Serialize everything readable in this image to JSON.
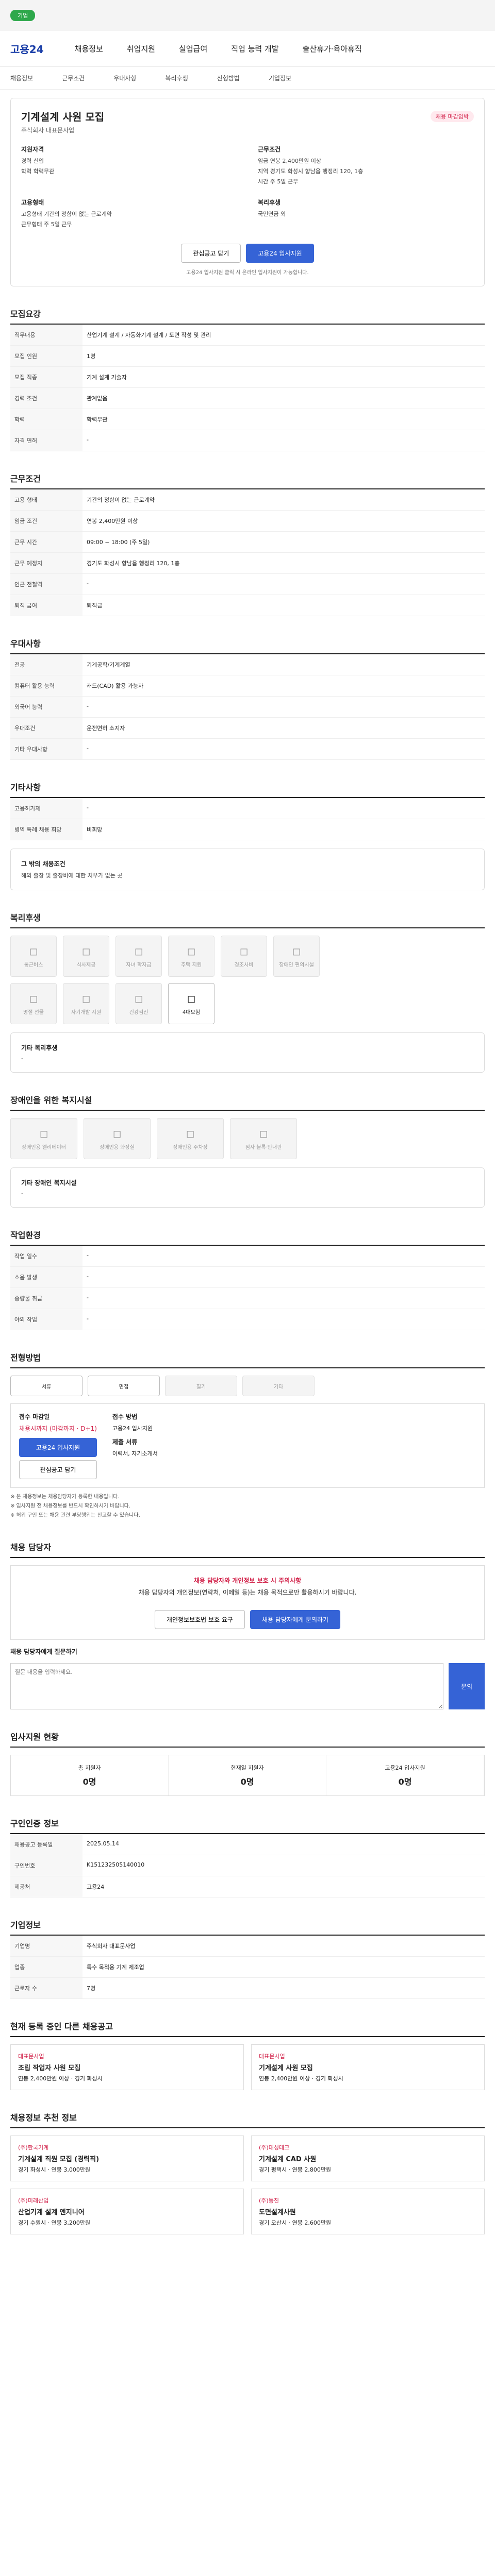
{
  "topbar": {
    "pill": "기업"
  },
  "header": {
    "logo": "고용24",
    "nav": [
      "채용정보",
      "취업지원",
      "실업급여",
      "직업 능력 개발",
      "출산휴가·육아휴직"
    ]
  },
  "subnav": [
    "채용정보",
    "근무조건",
    "우대사항",
    "복리후생",
    "전형방법",
    "기업정보"
  ],
  "summary": {
    "title": "기계설계 사원 모집",
    "badge": "채용 마감임박",
    "company": "주식회사 대표문사업",
    "left_title": "지원자격",
    "left_rows": [
      "경력 신입",
      "학력 학력무관"
    ],
    "right_title": "근무조건",
    "right_rows": [
      "임금 연봉 2,400만원 이상",
      "지역 경기도 화성시 향남읍 행정리 120, 1층",
      "시간 주 5일 근무"
    ],
    "left2_title": "고용형태",
    "left2_rows": [
      "고용형태 기간의 정함이 없는 근로계약",
      "근무형태 주 5일 근무"
    ],
    "right2_title": "복리후생",
    "right2_rows": [
      "국민연금 외"
    ],
    "save_label": "관심공고 담기",
    "apply_label": "고용24 입사지원",
    "note": "고용24 입사지원 클릭 시 온라인 입사지원이 가능합니다."
  },
  "sections": {
    "recruit": {
      "title": "모집요강",
      "rows": [
        {
          "k": "직무내용",
          "v": "산업기계 설계 / 자동화기계 설계 / 도면 작성 및 관리"
        },
        {
          "k": "모집 인원",
          "v": "1명"
        },
        {
          "k": "모집 직종",
          "v": "기계 설계 기술자"
        },
        {
          "k": "경력 조건",
          "v": "관계없음"
        },
        {
          "k": "학력",
          "v": "학력무관"
        },
        {
          "k": "자격 면허",
          "v": "-"
        }
      ]
    },
    "conditions": {
      "title": "근무조건",
      "rows": [
        {
          "k": "고용 형태",
          "v": "기간의 정함이 없는 근로계약"
        },
        {
          "k": "임금 조건",
          "v": "연봉 2,400만원 이상"
        },
        {
          "k": "근무 시간",
          "v": "09:00 ~ 18:00 (주 5일)"
        },
        {
          "k": "근무 예정지",
          "v": "경기도 화성시 향남읍 행정리 120, 1층"
        },
        {
          "k": "인근 전철역",
          "v": "-"
        },
        {
          "k": "퇴직 급여",
          "v": "퇴직금"
        }
      ]
    },
    "preference": {
      "title": "우대사항",
      "rows": [
        {
          "k": "전공",
          "v": "기계공학/기계계열"
        },
        {
          "k": "컴퓨터 활용 능력",
          "v": "캐드(CAD) 활용 가능자"
        },
        {
          "k": "외국어 능력",
          "v": "-"
        },
        {
          "k": "우대조건",
          "v": "운전면허 소지자"
        },
        {
          "k": "기타 우대사항",
          "v": "-"
        }
      ]
    },
    "other": {
      "title": "기타사항",
      "rows": [
        {
          "k": "고용허가제",
          "v": "-"
        },
        {
          "k": "병역 특례 채용 희망",
          "v": "비희망"
        }
      ],
      "free_text_title": "그 밖의 채용조건",
      "free_text": "해외 출장 및 출장비에 대한 처우가 없는 곳"
    },
    "welfare": {
      "title": "복리후생",
      "items": [
        "통근버스",
        "식사제공",
        "자녀 학자금",
        "주택 지원",
        "경조사비",
        "장애인 편의시설",
        "명절 선물",
        "자기개발 지원",
        "건강검진",
        "4대보험"
      ],
      "active_index": 9,
      "etc_title": "기타 복리후생",
      "etc_text": "-"
    },
    "disability": {
      "title": "장애인을 위한 복지시설",
      "items": [
        "장애인용 엘리베이터",
        "장애인용 화장실",
        "장애인용 주차장",
        "점자 블록·안내판"
      ],
      "etc_title": "기타 장애인 복지시설",
      "etc_text": "-"
    },
    "work_env": {
      "title": "작업환경",
      "rows": [
        {
          "k": "작업 일수",
          "v": "-"
        },
        {
          "k": "소음 발생",
          "v": "-"
        },
        {
          "k": "중량물 취급",
          "v": "-"
        },
        {
          "k": "야외 작업",
          "v": "-"
        }
      ]
    },
    "screening": {
      "title": "전형방법",
      "steps": [
        "서류",
        "면접",
        "필기",
        "기타"
      ],
      "apply_period_title": "접수 마감일",
      "deadline": "채용시까지 (마감까지 · D+1)",
      "method_title": "접수 방법",
      "method": "고용24 입사지원",
      "docs_title": "제출 서류",
      "docs": "이력서, 자기소개서",
      "apply_btn": "고용24 입사지원",
      "save_btn": "관심공고 담기",
      "notes": [
        "※ 본 채용정보는 채용담당자가 등록한 내용입니다.",
        "※ 입사지원 전 채용정보를 반드시 확인하시기 바랍니다.",
        "※ 허위 구인 또는 채용 관련 부당행위는 신고할 수 있습니다."
      ]
    },
    "contact": {
      "title": "채용 담당자",
      "alert_head": "채용 담당자와 개인정보 보호 시 주의사항",
      "alert_body": "채용 담당자의 개인정보(연락처, 이메일 등)는 채용 목적으로만 활용하시기 바랍니다.",
      "btn1": "개인정보보호법 보호 요구",
      "btn2": "채용 담당자에게 문의하기",
      "qa_title": "채용 담당자에게 질문하기",
      "qa_placeholder": "질문 내용을 입력하세요.",
      "qa_btn": "문의"
    },
    "stats": {
      "title": "입사지원 현황",
      "items": [
        {
          "label": "총 지원자",
          "value": "0명"
        },
        {
          "label": "현재일 지원자",
          "value": "0명"
        },
        {
          "label": "고용24 입사지원",
          "value": "0명"
        }
      ]
    },
    "info": {
      "title": "구인인증 정보",
      "rows": [
        {
          "k": "채용공고 등록일",
          "v": "2025.05.14"
        },
        {
          "k": "구인번호",
          "v": "K151232505140010"
        },
        {
          "k": "제공처",
          "v": "고용24"
        }
      ]
    },
    "company": {
      "title": "기업정보",
      "rows": [
        {
          "k": "기업명",
          "v": "주식회사 대표문사업"
        },
        {
          "k": "업종",
          "v": "특수 목적용 기계 제조업"
        },
        {
          "k": "근로자 수",
          "v": "7명"
        }
      ]
    },
    "related": {
      "title": "현재 등록 중인 다른 채용공고",
      "jobs": [
        {
          "co": "대표문사업",
          "nm": "조립 작업자 사원 모집",
          "info": "연봉 2,400만원 이상 · 경기 화성시"
        },
        {
          "co": "대표문사업",
          "nm": "기계설계 사원 모집",
          "info": "연봉 2,400만원 이상 · 경기 화성시"
        }
      ]
    },
    "similar": {
      "title": "채용정보 추천 정보",
      "jobs": [
        {
          "co": "(주)한국기계",
          "nm": "기계설계 직원 모집 (경력직)",
          "info": "경기 화성시 · 연봉 3,000만원"
        },
        {
          "co": "(주)대성테크",
          "nm": "기계설계 CAD 사원",
          "info": "경기 평택시 · 연봉 2,800만원"
        },
        {
          "co": "(주)미래산업",
          "nm": "산업기계 설계 엔지니어",
          "info": "경기 수원시 · 연봉 3,200만원"
        },
        {
          "co": "(주)동진",
          "nm": "도면설계사원",
          "info": "경기 오산시 · 연봉 2,600만원"
        }
      ]
    }
  }
}
